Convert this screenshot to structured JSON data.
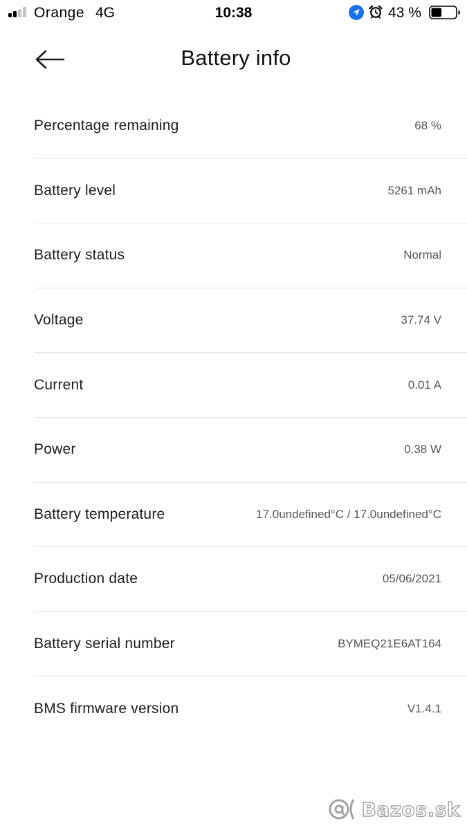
{
  "status_bar": {
    "carrier": "Orange",
    "network": "4G",
    "time": "10:38",
    "battery_percent": "43 %",
    "battery_level_fraction": 0.43,
    "signal_bars_total": 4,
    "signal_bars_active": 2,
    "icons": [
      "signal-icon",
      "location-icon",
      "alarm-icon",
      "battery-icon"
    ]
  },
  "header": {
    "title": "Battery info",
    "back_icon": "arrow-left-icon"
  },
  "rows": [
    {
      "label": "Percentage remaining",
      "value": "68 %"
    },
    {
      "label": "Battery level",
      "value": "5261 mAh"
    },
    {
      "label": "Battery status",
      "value": "Normal"
    },
    {
      "label": "Voltage",
      "value": "37.74 V"
    },
    {
      "label": "Current",
      "value": "0.01 A"
    },
    {
      "label": "Power",
      "value": "0.38 W"
    },
    {
      "label": "Battery temperature",
      "value": "17.0undefined°C / 17.0undefined°C"
    },
    {
      "label": "Production date",
      "value": "05/06/2021"
    },
    {
      "label": "Battery serial number",
      "value": "BYMEQ21E6AT164"
    },
    {
      "label": "BMS firmware version",
      "value": "V1.4.1"
    }
  ],
  "watermark": {
    "text": "Bazos.sk"
  },
  "colors": {
    "accent_location": "#1a73e8",
    "divider": "#e3e3e3",
    "value_text": "#555555",
    "label_text": "#1c1c1c"
  }
}
